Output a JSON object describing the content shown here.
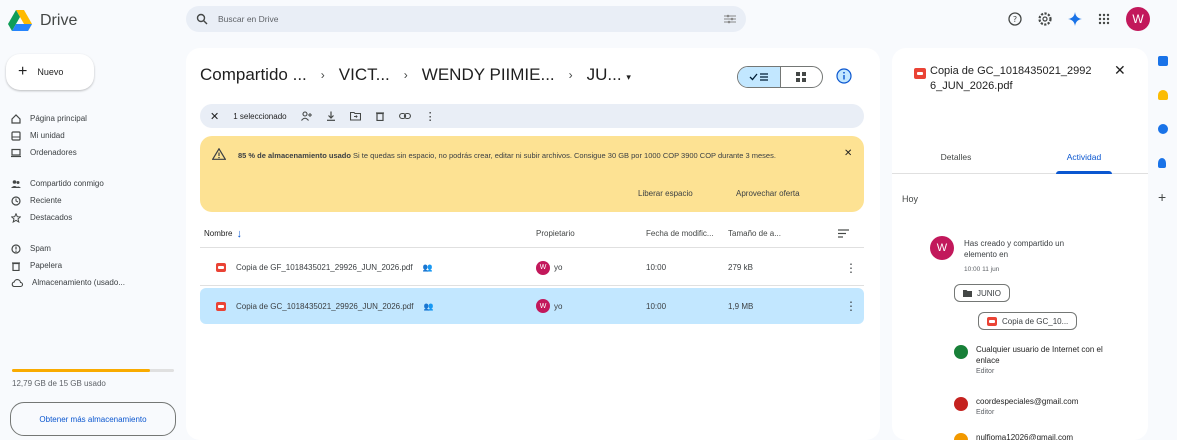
{
  "app": {
    "name": "Drive"
  },
  "search": {
    "placeholder": "Buscar en Drive"
  },
  "header": {
    "avatar_letter": "W"
  },
  "sidebar": {
    "new_label": "Nuevo",
    "group1": [
      {
        "label": "Página principal",
        "icon": "home-icon"
      },
      {
        "label": "Mi unidad",
        "icon": "drive-icon"
      },
      {
        "label": "Ordenadores",
        "icon": "computer-icon"
      }
    ],
    "group2": [
      {
        "label": "Compartido conmigo",
        "icon": "people-icon"
      },
      {
        "label": "Reciente",
        "icon": "clock-icon"
      },
      {
        "label": "Destacados",
        "icon": "star-icon"
      }
    ],
    "group3": [
      {
        "label": "Spam",
        "icon": "spam-icon"
      },
      {
        "label": "Papelera",
        "icon": "trash-icon"
      },
      {
        "label": "Almacenamiento (usado...",
        "icon": "cloud-icon"
      }
    ],
    "storage_used_fraction": 0.85,
    "storage_text": "12,79 GB de 15 GB usado",
    "more_storage_label": "Obtener más almacenamiento"
  },
  "breadcrumb": {
    "items": [
      "Compartido ...",
      "VICT...",
      "WENDY PIIMIE...",
      "JU..."
    ],
    "separator": "›"
  },
  "selection_bar": {
    "label": "1 seleccionado"
  },
  "warning": {
    "bold": "85 % de almacenamiento usado",
    "text": " Si te quedas sin espacio, no podrás crear, editar ni subir archivos. Consigue 30 GB por 1000 COP 3900 COP durante 3 meses.",
    "free_space": "Liberar espacio",
    "offer": "Aprovechar oferta"
  },
  "table": {
    "headers": {
      "name": "Nombre",
      "owner": "Propietario",
      "date": "Fecha de modific...",
      "size": "Tamaño de a..."
    },
    "rows": [
      {
        "name": "Copia de GF_1018435021_29926_JUN_2026.pdf",
        "owner": "yo",
        "date": "10:00",
        "size": "279 kB",
        "selected": false
      },
      {
        "name": "Copia de GC_1018435021_29926_JUN_2026.pdf",
        "owner": "yo",
        "date": "10:00",
        "size": "1,9 MB",
        "selected": true
      }
    ]
  },
  "details": {
    "title": "Copia de GC_1018435021_29926_JUN_2026.pdf",
    "tab_details": "Detalles",
    "tab_activity": "Actividad",
    "day": "Hoy",
    "activity_text": "Has creado y compartido un elemento en",
    "activity_time": "10:00 11 jun",
    "folder_chip": "JUNIO",
    "file_chip": "Copia de GC_10...",
    "shares": [
      {
        "name": "Cualquier usuario de Internet con el enlace",
        "role": "Editor",
        "color": "#188038"
      },
      {
        "name": "coordespeciales@gmail.com",
        "role": "Editor",
        "color": "#c5221f"
      },
      {
        "name": "nulfioma12026@gmail.com",
        "role": "",
        "color": "#f29900"
      }
    ]
  },
  "colors": {
    "accent": "#0b57d0",
    "selected_row": "#c2e7ff",
    "warning_bg": "#fde293"
  }
}
